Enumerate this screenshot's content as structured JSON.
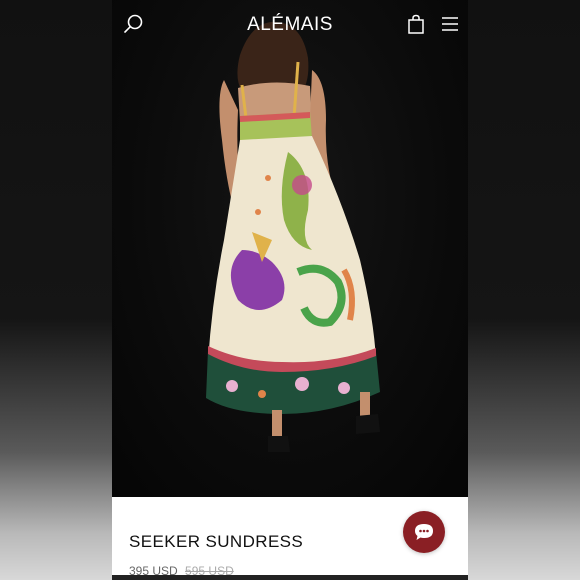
{
  "header": {
    "brand": "ALÉMAIS",
    "icons": [
      "search-icon",
      "shopping-bag-icon",
      "hamburger-menu-icon"
    ]
  },
  "product": {
    "name": "SEEKER SUNDRESS",
    "price": "395 USD",
    "original_price": "595 USD"
  },
  "chat": {
    "icon": "chat-bubble-icon",
    "color": "#8a1f24"
  },
  "colors": {
    "header_text": "#ffffff",
    "background": "#000000",
    "accent": "#8a1f24"
  }
}
